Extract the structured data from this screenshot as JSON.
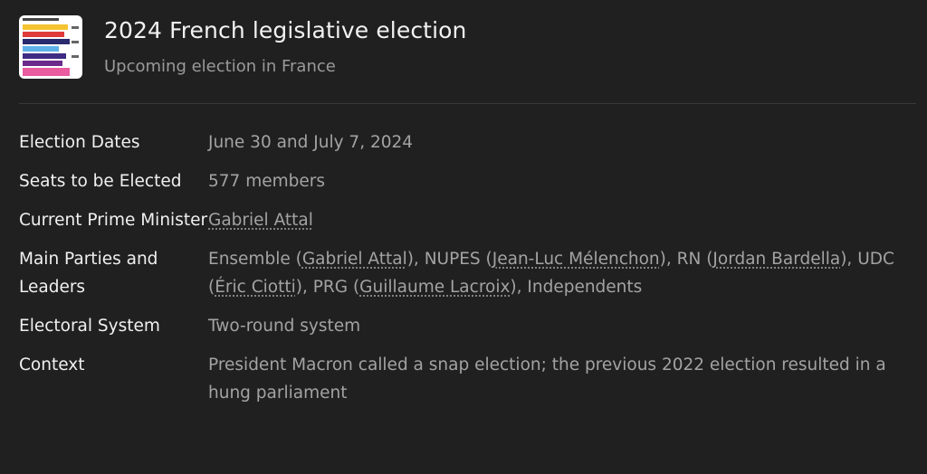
{
  "header": {
    "title": "2024 French legislative election",
    "subtitle": "Upcoming election in France",
    "thumbnail_bar_colors": [
      "#f4c430",
      "#e03a3a",
      "#2a2a6e",
      "#5fb0e8",
      "#3f2b83",
      "#6c2a8a",
      "#e95ca0"
    ]
  },
  "rows": [
    {
      "label": "Election Dates",
      "value": "June 30 and July 7, 2024"
    },
    {
      "label": "Seats to be Elected",
      "value": "577 members"
    },
    {
      "label": "Current Prime Minister",
      "link": "Gabriel Attal"
    },
    {
      "label": "Main Parties and Leaders",
      "parts": {
        "p1": "Ensemble (",
        "l1": "Gabriel Attal",
        "p2": "), NUPES (",
        "l2": "Jean-Luc Mélenchon",
        "p3": "), RN (",
        "l3": "Jordan Bardella",
        "p4": "), UDC (",
        "l4": "Éric Ciotti",
        "p5": "), PRG (",
        "l5": "Guillaume Lacroix",
        "p6": "), Independents"
      }
    },
    {
      "label": "Electoral System",
      "value": "Two-round system"
    },
    {
      "label": "Context",
      "value": "President Macron called a snap election; the previous 2022 election resulted in a hung parliament"
    }
  ]
}
